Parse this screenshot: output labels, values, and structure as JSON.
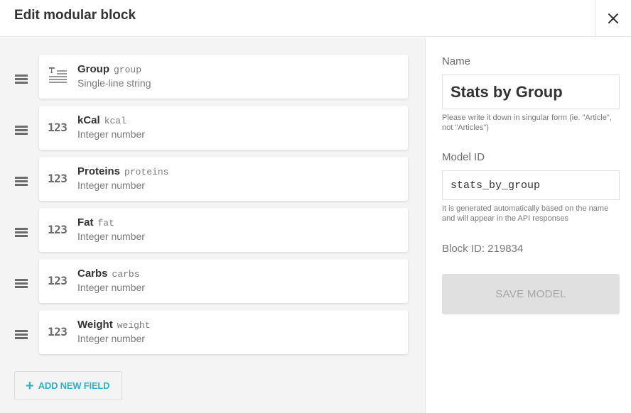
{
  "header": {
    "title": "Edit modular block",
    "close_icon": "close-icon"
  },
  "fields": [
    {
      "name": "Group",
      "api_key": "group",
      "type": "Single-line string",
      "icon": "text-field-icon"
    },
    {
      "name": "kCal",
      "api_key": "kcal",
      "type": "Integer number",
      "icon": "123"
    },
    {
      "name": "Proteins",
      "api_key": "proteins",
      "type": "Integer number",
      "icon": "123"
    },
    {
      "name": "Fat",
      "api_key": "fat",
      "type": "Integer number",
      "icon": "123"
    },
    {
      "name": "Carbs",
      "api_key": "carbs",
      "type": "Integer number",
      "icon": "123"
    },
    {
      "name": "Weight",
      "api_key": "weight",
      "type": "Integer number",
      "icon": "123"
    }
  ],
  "add_field": {
    "plus": "+",
    "label": "ADD NEW FIELD"
  },
  "form": {
    "name_label": "Name",
    "name_value": "Stats by Group",
    "name_hint": "Please write it down in singular form (ie. \"Article\", not \"Articles\")",
    "model_id_label": "Model ID",
    "model_id_value": "stats_by_group",
    "model_id_hint": "It is generated automatically based on the name and will appear in the API responses",
    "block_id": "Block ID: 219834",
    "save_label": "SAVE MODEL"
  },
  "colors": {
    "accent": "#2fb2c9",
    "panel_bg": "#f4f4f4",
    "disabled_btn": "#e0e0e0"
  }
}
